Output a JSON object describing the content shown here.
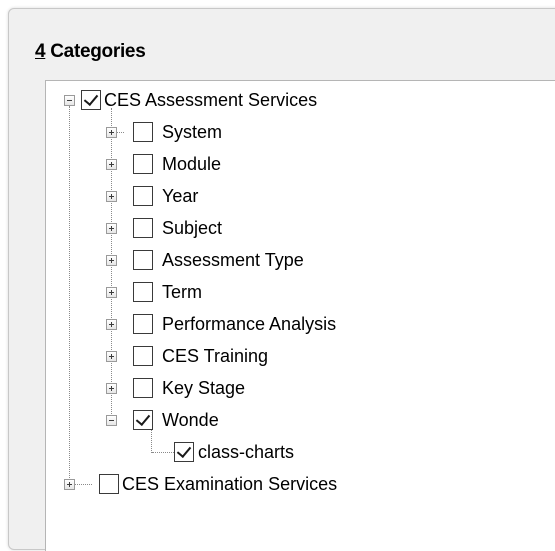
{
  "group": {
    "title_hotkey": "4",
    "title_rest": " Categories"
  },
  "tree": {
    "root1": {
      "label": "CES Assessment Services",
      "checked": true,
      "expanded": true
    },
    "children": [
      {
        "label": "System",
        "checked": false
      },
      {
        "label": "Module",
        "checked": false
      },
      {
        "label": "Year",
        "checked": false
      },
      {
        "label": "Subject",
        "checked": false
      },
      {
        "label": "Assessment Type",
        "checked": false
      },
      {
        "label": "Term",
        "checked": false
      },
      {
        "label": "Performance Analysis",
        "checked": false
      },
      {
        "label": "CES Training",
        "checked": false
      },
      {
        "label": "Key Stage",
        "checked": false
      },
      {
        "label": "Wonde",
        "checked": true,
        "expanded": true
      }
    ],
    "grandchild": {
      "label": "class-charts",
      "checked": true
    },
    "root2": {
      "label": "CES Examination Services",
      "checked": false,
      "expanded": false
    }
  }
}
